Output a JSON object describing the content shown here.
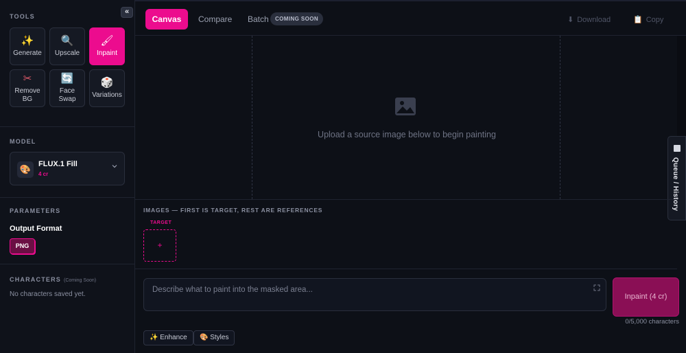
{
  "sidebar": {
    "collapse_icon": "«",
    "tools_title": "TOOLS",
    "tools": [
      {
        "label": "Generate",
        "icon": "✨"
      },
      {
        "label": "Upscale",
        "icon": "🔍"
      },
      {
        "label": "Inpaint",
        "icon": "🖌",
        "active": true
      },
      {
        "label": "Remove BG",
        "icon": "✂"
      },
      {
        "label": "Face Swap",
        "icon": "🔄"
      },
      {
        "label": "Variations",
        "icon": "🎲"
      }
    ],
    "model_title": "MODEL",
    "model": {
      "icon": "🎨",
      "name": "FLUX.1 Fill",
      "cost": "4 cr"
    },
    "parameters_title": "PARAMETERS",
    "output_format_label": "Output Format",
    "output_format_value": "PNG",
    "characters_title": "CHARACTERS",
    "characters_coming_soon": "(Coming Soon)",
    "no_characters": "No characters saved yet."
  },
  "topbar": {
    "tabs": [
      "Canvas",
      "Compare",
      "Batch"
    ],
    "batch_badge": "COMING SOON",
    "download_label": "Download",
    "copy_label": "Copy"
  },
  "canvas": {
    "placeholder": "Upload a source image below to begin painting"
  },
  "queue": {
    "label": "Queue / History"
  },
  "images": {
    "title": "IMAGES — FIRST IS TARGET, REST ARE REFERENCES",
    "target_label": "TARGET",
    "add_icon": "+"
  },
  "prompt": {
    "placeholder": "Describe what to paint into the masked area...",
    "submit_label": "Inpaint (4 cr)",
    "char_count": "0/5,000 characters",
    "enhance_label": "✨ Enhance",
    "styles_label": "🎨 Styles"
  },
  "colors": {
    "accent": "#ec0c8e",
    "background": "#0d1017"
  }
}
